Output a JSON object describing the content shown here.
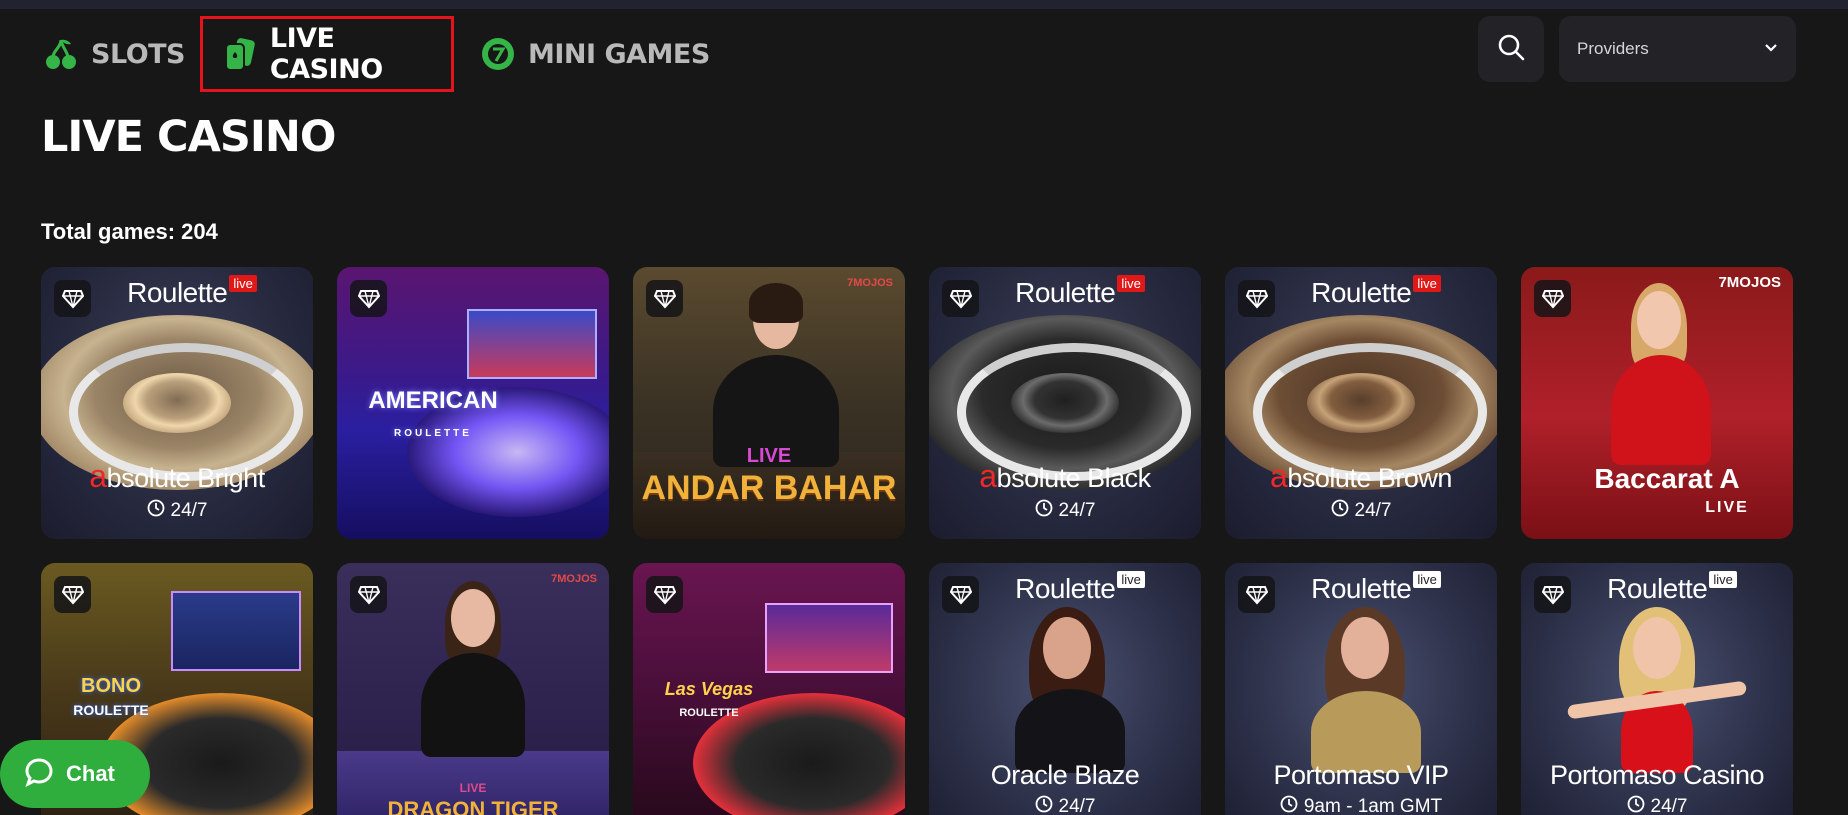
{
  "nav": {
    "slots": "SLOTS",
    "live_casino": "LIVE CASINO",
    "mini_games": "MINI GAMES"
  },
  "providers": {
    "label": "Providers"
  },
  "page": {
    "title": "LIVE CASINO",
    "total_games": "Total games: 204"
  },
  "chat": {
    "label": "Chat"
  },
  "games": [
    {
      "brand": "Roulette",
      "brand_badge": "live",
      "name_prefix": "a",
      "name": "bsolute Bright",
      "hours": "24/7"
    },
    {
      "name": "American Roulette",
      "logo_text": "AMERICAN",
      "logo_sub": "ROULETTE"
    },
    {
      "name": "Andar Bahar",
      "live_text": "LIVE",
      "logo_text": "ANDAR BAHAR",
      "provider": "7MOJOS"
    },
    {
      "brand": "Roulette",
      "brand_badge": "live",
      "name_prefix": "a",
      "name": "bsolute Black",
      "hours": "24/7"
    },
    {
      "brand": "Roulette",
      "brand_badge": "live",
      "name_prefix": "a",
      "name": "bsolute Brown",
      "hours": "24/7"
    },
    {
      "name": "Baccarat A",
      "logo_text": "Baccarat A",
      "live_text": "LIVE",
      "provider": "7MOJOS"
    },
    {
      "name": "Bono Roulette",
      "logo_text": "BONO",
      "logo_sub": "ROULETTE"
    },
    {
      "name": "Dragon Tiger",
      "live_text": "LIVE",
      "logo_text": "DRAGON TIGER",
      "provider": "7MOJOS"
    },
    {
      "name": "Las Vegas Roulette",
      "logo_text": "Las Vegas",
      "logo_sub": "ROULETTE"
    },
    {
      "brand": "Roulette",
      "brand_badge": "live",
      "name": "Oracle Blaze",
      "hours": "24/7"
    },
    {
      "brand": "Roulette",
      "brand_badge": "live",
      "name": "Portomaso VIP",
      "hours": "9am - 1am GMT"
    },
    {
      "brand": "Roulette",
      "brand_badge": "live",
      "name": "Portomaso Casino",
      "hours": "24/7"
    }
  ],
  "colors": {
    "accent_green": "#35b548",
    "active_border": "#e4131c",
    "background": "#171717"
  }
}
